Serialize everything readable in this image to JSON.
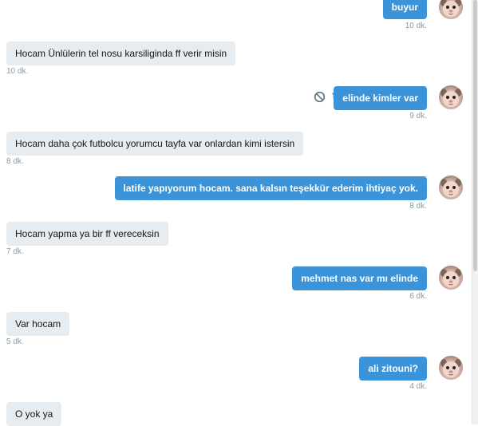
{
  "conversation": {
    "messages": [
      {
        "side": "out",
        "text": "buyur",
        "time": "10 dk."
      },
      {
        "side": "in",
        "text": "Hocam Ünlülerin tel nosu karsiliginda ff verir misin",
        "time": "10 dk."
      },
      {
        "side": "out",
        "text": "elinde kimler var",
        "time": "9 dk."
      },
      {
        "side": "in",
        "text": "Hocam daha çok futbolcu yorumcu tayfa var onlardan kimi istersin",
        "time": "8 dk."
      },
      {
        "side": "out",
        "text": "latife yapıyorum hocam. sana kalsın teşekkür ederim ihtiyaç yok.",
        "time": "8 dk."
      },
      {
        "side": "in",
        "text": "Hocam yapma ya bir ff vereceksin",
        "time": "7 dk."
      },
      {
        "side": "out",
        "text": "mehmet nas var mı elinde",
        "time": "6 dk."
      },
      {
        "side": "in",
        "text": "Var hocam",
        "time": "5 dk."
      },
      {
        "side": "out",
        "text": "ali zitouni?",
        "time": "4 dk."
      },
      {
        "side": "in",
        "text": "O yok ya",
        "time": ""
      }
    ]
  },
  "icons": {
    "block": "block-icon",
    "delete": "trash-icon"
  },
  "colors": {
    "outgoing_bubble": "#3b94d9",
    "incoming_bubble": "#e6ecf0",
    "timestamp": "#8899a6",
    "action_icon": "#66757f"
  }
}
